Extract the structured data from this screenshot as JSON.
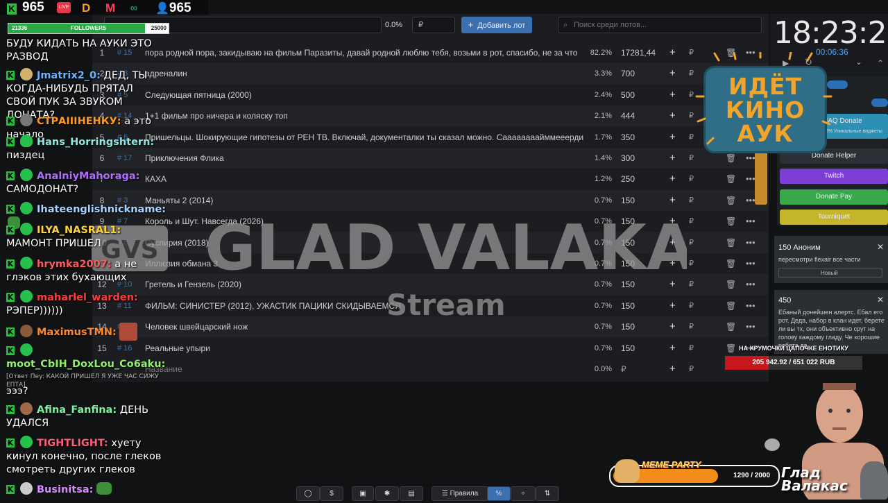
{
  "overlay": {
    "viewers": "965",
    "viewers2": "965",
    "followers_label": "FOLLOWERS",
    "followers_current": "21336",
    "followers_goal": "25000",
    "followers_progress": 0.853
  },
  "auction": {
    "search_placeholder": "Поиск среди лотов...",
    "top_percent": "0.0%",
    "currency_symbol": "₽",
    "add_lot_label": "Добавить лот",
    "new_lot_placeholder": "Название",
    "new_lot_percent": "0.0%",
    "lots": [
      {
        "num": "1",
        "id": "# 15",
        "name": "пора родной пора, закидываю на фильм Паразиты, давай родной люблю тебя, возьми в рот, спасибо, не за что",
        "pct": "82.2%",
        "amount": "17281,44"
      },
      {
        "num": "2",
        "id": "# 3",
        "name": "адреналин",
        "pct": "3.3%",
        "amount": "700"
      },
      {
        "num": "3",
        "id": "# 5",
        "name": "Следующая пятница (2000)",
        "pct": "2.4%",
        "amount": "500"
      },
      {
        "num": "4",
        "id": "# 14",
        "name": "1+1 фильм про ничера и коляску топ",
        "pct": "2.1%",
        "amount": "444"
      },
      {
        "num": "5",
        "id": "# 6",
        "name": "Пришельцы. Шокирующие гипотезы от РЕН ТВ. Включай, документалки ты сказал можно. Саааааааайммееерди",
        "pct": "1.7%",
        "amount": "350"
      },
      {
        "num": "6",
        "id": "# 17",
        "name": "Приключения Флика",
        "pct": "1.4%",
        "amount": "300"
      },
      {
        "num": "7",
        "id": "# 2",
        "name": "КАХА",
        "pct": "1.2%",
        "amount": "250"
      },
      {
        "num": "8",
        "id": "# 3",
        "name": "Маньяты 2 (2014)",
        "pct": "0.7%",
        "amount": "150"
      },
      {
        "num": "9",
        "id": "# 7",
        "name": "Король и Шут. Навсегда (2026)",
        "pct": "0.7%",
        "amount": "150"
      },
      {
        "num": "10",
        "id": "# 8",
        "name": "Суспирия (2018)",
        "pct": "0.7%",
        "amount": "150"
      },
      {
        "num": "11",
        "id": "# 9",
        "name": "Иллюзия обмана 3",
        "pct": "0.7%",
        "amount": "150"
      },
      {
        "num": "12",
        "id": "# 10",
        "name": "Гретель и Гензель (2020)",
        "pct": "0.7%",
        "amount": "150"
      },
      {
        "num": "13",
        "id": "# 11",
        "name": "ФИЛЬМ: СИНИСТЕР (2012), УЖАСТИК ПАЦИКИ СКИДЫВАЕМСЯ",
        "pct": "0.7%",
        "amount": "150"
      },
      {
        "num": "14",
        "id": "# 12",
        "name": "Человек швейцарский нож",
        "pct": "0.7%",
        "amount": "150"
      },
      {
        "num": "15",
        "id": "# 16",
        "name": "Реальные упыри",
        "pct": "0.7%",
        "amount": "150"
      }
    ]
  },
  "watermark": {
    "title": "GLAD VALAKAS",
    "subtitle": "Stream"
  },
  "sign": {
    "line1": "ИДЁТ",
    "line2": "КИНО",
    "line3": "АУК"
  },
  "timer": {
    "clock": "18:23:23",
    "elapsed": "00:06:36"
  },
  "widgets": {
    "donate_haq": "HAQ Donate",
    "donate_haq_sub": "50% Уникальные виджеты",
    "donate_helper": "Donate Helper",
    "twitch": "Twitch",
    "donate_pay": "Donate Pay",
    "tourniquet": "Tourniquet"
  },
  "alerts": {
    "a1_title": "150 Аноним",
    "a1_text": "пересмотри flexair все части",
    "a1_select": "Новый",
    "a2_title": "450",
    "a2_text": "Ебаный донейшен алертс. Ебал его рот. Деда, набор в клан идет, берете ли вы тх, они объективно срут на голову каждому гладу. Че хорошие ребята да"
  },
  "goal": {
    "title": "НА ХРУМОЧКИ ЦАПОЧКЕ ЕНОТИКУ",
    "progress": "205 942.92 / 651 022 RUB",
    "fraction": 0.316
  },
  "meme": {
    "label": "MEME PARTY",
    "progress": "1290 / 2000",
    "fraction": 0.645
  },
  "streamer": {
    "name_line1": "Глад",
    "name_line2": "Валакас"
  },
  "bottom_bar": {
    "rules": "Правила",
    "percent": "%"
  },
  "chat": [
    {
      "nick": "",
      "text": "БУДУ КИДАТЬ НА АУКИ ЭТО РАЗВОД"
    },
    {
      "nick": "Jmatrix2_0:",
      "text": "ДЕД, ТЫ КОГДА-НИБУДЬ ПРЯТАЛ СВОЙ ПУК ЗА ЗВУКОМ ДОНАТА?"
    },
    {
      "nick": "СТРАIIIНЕНКУ:",
      "text": "а это начало"
    },
    {
      "nick": "Hans_Horringshtern:",
      "text": "пиздец"
    },
    {
      "nick": "AnalniyMahoraga:",
      "text": "САМОДОНАТ?"
    },
    {
      "nick": "Ihateenglishnickname:",
      "text": ""
    },
    {
      "nick": "ILYA_NASRAL1:",
      "text": "МАМОНТ ПРИШЕЛ"
    },
    {
      "nick": "hrymka2007:",
      "text": "а не глэков этих бухающих"
    },
    {
      "nick": "maharlel_warden:",
      "text": "РЭПЕР))))))"
    },
    {
      "nick": "MaximusTMN:",
      "text": ""
    },
    {
      "nick": "moot_CbIH_DoxLou_Co6aku:",
      "text": "эээ?"
    },
    {
      "nick": "",
      "text": "[Ответ Пеy: КАКОЙ ПРИШЕЛ Я УЖЕ ЧАС СИЖУ ЕПТА]"
    },
    {
      "nick": "Afina_Fanfina:",
      "text": "ДЕНЬ УДАЛСЯ"
    },
    {
      "nick": "TIGHTLIGHT:",
      "text": "хуету кинул конечно, после глеков смотреть других глеков"
    },
    {
      "nick": "Businitsa:",
      "text": ""
    }
  ],
  "colors": {
    "accent": "#3a6fb0",
    "kick_green": "#26c03a",
    "goal_red": "#c8171c"
  }
}
